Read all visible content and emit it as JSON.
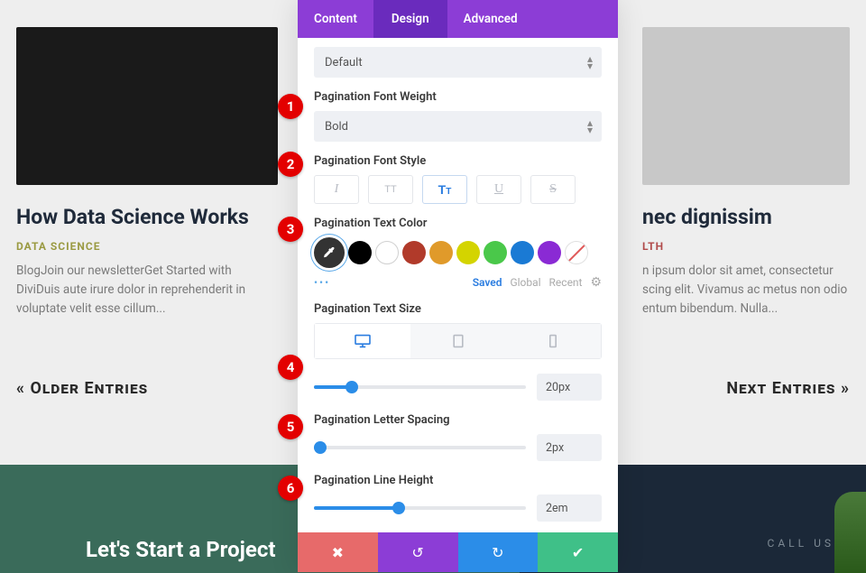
{
  "bg": {
    "card1": {
      "title": "How Data Science Works",
      "category": "DATA SCIENCE",
      "excerpt": "BlogJoin our newsletterGet Started with DiviDuis aute irure dolor in reprehenderit in voluptate velit esse cillum..."
    },
    "card2": {
      "title": "nec dignissim",
      "category": "LTH",
      "excerpt": "n ipsum dolor sit amet, consectetur scing elit. Vivamus ac metus non odio entum bibendum. Nulla..."
    },
    "older": "« Older Entries",
    "next": "Next Entries »",
    "project": "Let's Start a Project",
    "callus": "CALL US"
  },
  "tabs": {
    "content": "Content",
    "design": "Design",
    "advanced": "Advanced"
  },
  "panel": {
    "select_default": "Default",
    "weight_label": "Pagination Font Weight",
    "weight_value": "Bold",
    "style_label": "Pagination Font Style",
    "color_label": "Pagination Text Color",
    "meta": {
      "saved": "Saved",
      "global": "Global",
      "recent": "Recent"
    },
    "size_label": "Pagination Text Size",
    "size_value": "20px",
    "spacing_label": "Pagination Letter Spacing",
    "spacing_value": "2px",
    "lineheight_label": "Pagination Line Height",
    "lineheight_value": "2em"
  },
  "colors": {
    "black": "#000000",
    "white": "#ffffff",
    "red": "#b13a2a",
    "orange": "#e09a2a",
    "yellow": "#d4d400",
    "green": "#4ac84a",
    "blue": "#1a7ad4",
    "purple": "#8a2ad4"
  },
  "badges": [
    "1",
    "2",
    "3",
    "4",
    "5",
    "6"
  ]
}
